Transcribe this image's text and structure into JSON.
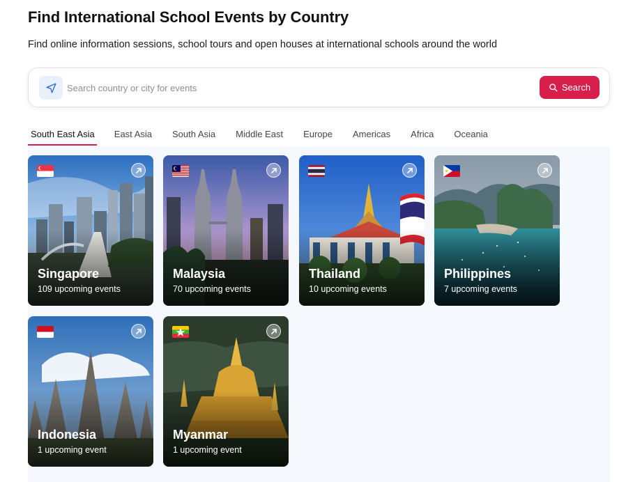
{
  "page": {
    "title": "Find International School Events by Country",
    "subtitle": "Find online information sessions, school tours and open houses at international schools around the world"
  },
  "search": {
    "placeholder": "Search country or city for events",
    "button_label": "Search",
    "icon": "navigation-arrow-icon"
  },
  "colors": {
    "accent": "#d81e4a",
    "panel_bg": "#f5f8fc"
  },
  "tabs": [
    {
      "label": "South East Asia",
      "active": true
    },
    {
      "label": "East Asia",
      "active": false
    },
    {
      "label": "South Asia",
      "active": false
    },
    {
      "label": "Middle East",
      "active": false
    },
    {
      "label": "Europe",
      "active": false
    },
    {
      "label": "Americas",
      "active": false
    },
    {
      "label": "Africa",
      "active": false
    },
    {
      "label": "Oceania",
      "active": false
    }
  ],
  "countries": [
    {
      "name": "Singapore",
      "events": "109 upcoming events",
      "flag": "singapore-flag-icon"
    },
    {
      "name": "Malaysia",
      "events": "70 upcoming events",
      "flag": "malaysia-flag-icon"
    },
    {
      "name": "Thailand",
      "events": "10 upcoming events",
      "flag": "thailand-flag-icon"
    },
    {
      "name": "Philippines",
      "events": "7 upcoming events",
      "flag": "philippines-flag-icon"
    },
    {
      "name": "Indonesia",
      "events": "1 upcoming event",
      "flag": "indonesia-flag-icon"
    },
    {
      "name": "Myanmar",
      "events": "1 upcoming event",
      "flag": "myanmar-flag-icon"
    }
  ]
}
